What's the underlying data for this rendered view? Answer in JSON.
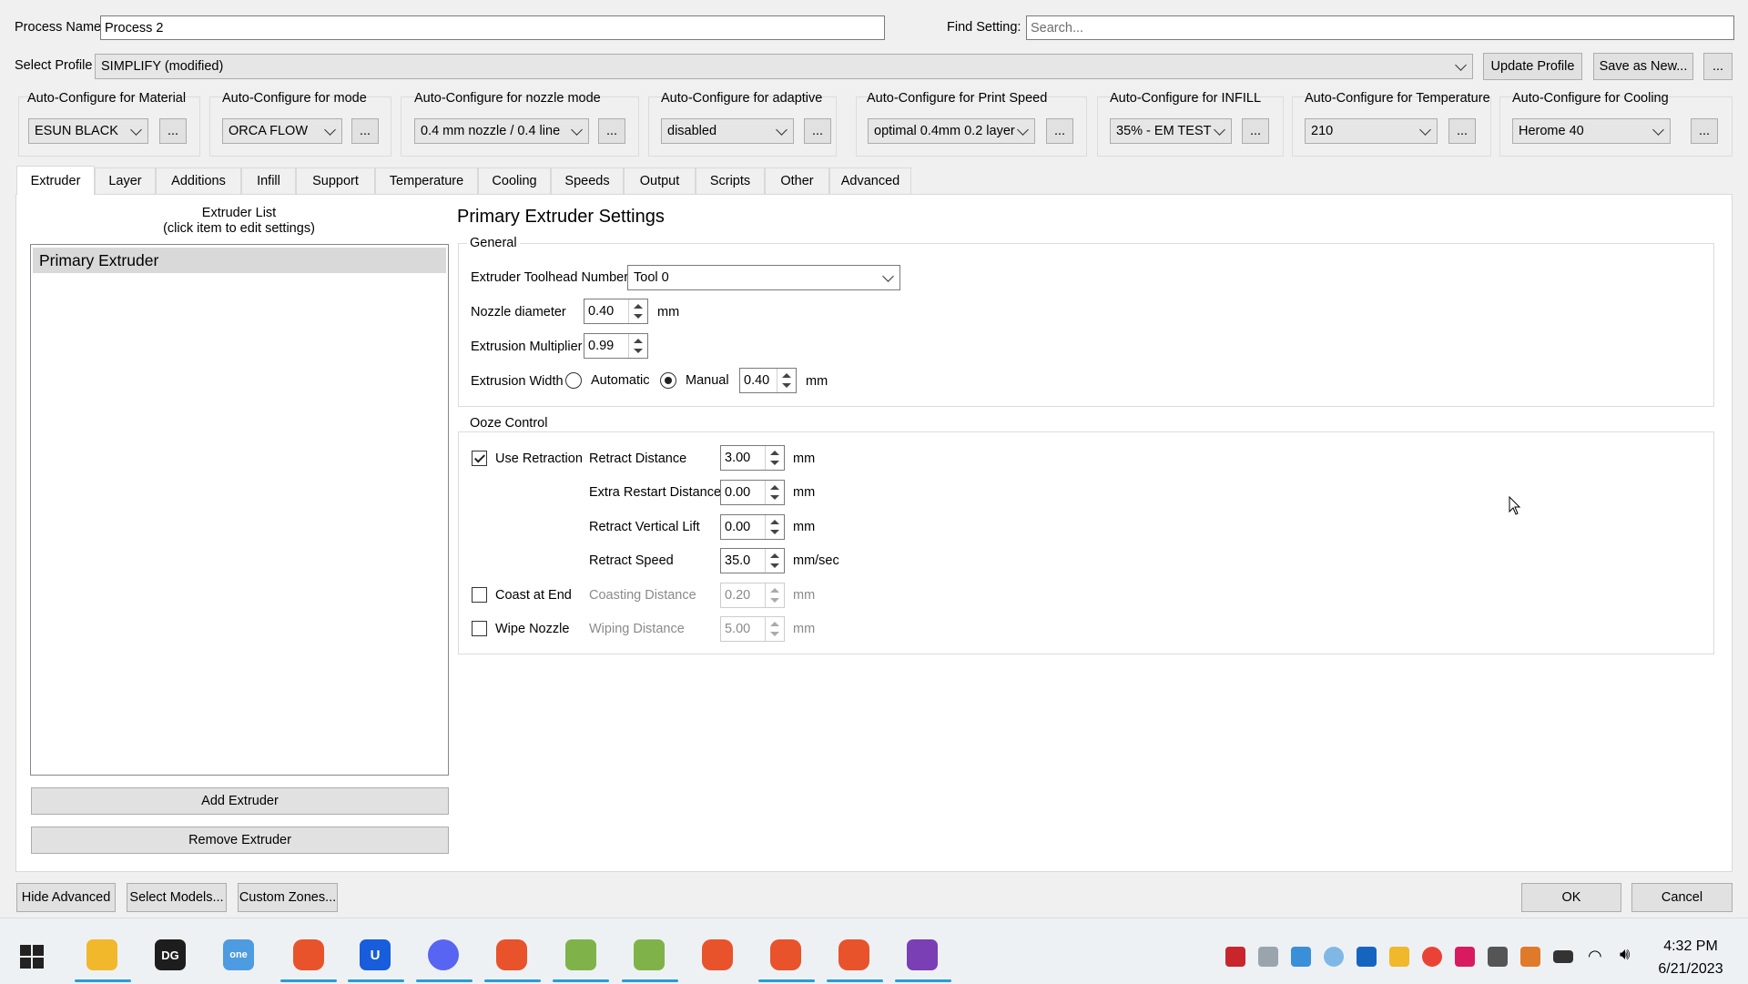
{
  "top": {
    "process_name_label": "Process Name",
    "process_name_value": "Process 2",
    "find_setting_label": "Find Setting:",
    "find_setting_placeholder": "Search...",
    "select_profile_label": "Select Profile",
    "select_profile_value": "SIMPLIFY (modified)",
    "update_profile": "Update Profile",
    "save_as_new": "Save as New...",
    "more": "..."
  },
  "autoconfig": [
    {
      "label": "Auto-Configure for Material",
      "value": "ESUN BLACK"
    },
    {
      "label": "Auto-Configure for mode",
      "value": "ORCA FLOW"
    },
    {
      "label": "Auto-Configure for nozzle mode",
      "value": "0.4 mm nozzle / 0.4 line"
    },
    {
      "label": "Auto-Configure for adaptive",
      "value": "disabled"
    },
    {
      "label": "Auto-Configure for Print Speed",
      "value": "optimal 0.4mm 0.2 layer"
    },
    {
      "label": "Auto-Configure for INFILL",
      "value": "35% - EM TEST"
    },
    {
      "label": "Auto-Configure for Temperature",
      "value": "210"
    },
    {
      "label": "Auto-Configure for Cooling",
      "value": "Herome 40"
    }
  ],
  "tabs": [
    "Extruder",
    "Layer",
    "Additions",
    "Infill",
    "Support",
    "Temperature",
    "Cooling",
    "Speeds",
    "Output",
    "Scripts",
    "Other",
    "Advanced"
  ],
  "extruder_list": {
    "title_line1": "Extruder List",
    "title_line2": "(click item to edit settings)",
    "items": [
      "Primary Extruder"
    ],
    "add_button": "Add Extruder",
    "remove_button": "Remove Extruder"
  },
  "settings": {
    "heading": "Primary Extruder Settings",
    "general_title": "General",
    "toolhead_label": "Extruder Toolhead Number",
    "toolhead_value": "Tool 0",
    "nozzle_label": "Nozzle diameter",
    "nozzle_value": "0.40",
    "nozzle_unit": "mm",
    "multiplier_label": "Extrusion Multiplier",
    "multiplier_value": "0.99",
    "width_label": "Extrusion Width",
    "width_auto": "Automatic",
    "width_manual": "Manual",
    "width_value": "0.40",
    "width_unit": "mm",
    "ooze_title": "Ooze Control",
    "use_retraction": "Use Retraction",
    "retract_distance_label": "Retract Distance",
    "retract_distance_value": "3.00",
    "extra_restart_label": "Extra Restart Distance",
    "extra_restart_value": "0.00",
    "vertical_lift_label": "Retract Vertical Lift",
    "vertical_lift_value": "0.00",
    "retract_speed_label": "Retract Speed",
    "retract_speed_value": "35.0",
    "coast_label": "Coast at End",
    "coasting_distance_label": "Coasting Distance",
    "coasting_distance_value": "0.20",
    "wipe_label": "Wipe Nozzle",
    "wiping_distance_label": "Wiping Distance",
    "wiping_distance_value": "5.00",
    "unit_mm": "mm",
    "unit_mmsec": "mm/sec"
  },
  "bottom": {
    "hide_advanced": "Hide Advanced",
    "select_models": "Select Models...",
    "custom_zones": "Custom Zones...",
    "ok": "OK",
    "cancel": "Cancel"
  },
  "taskbar": {
    "time": "4:32 PM",
    "date": "6/21/2023",
    "icons": [
      "windows-start-icon",
      "file-explorer-icon",
      "datagrip-icon",
      "onenote-icon",
      "brave-icon",
      "bitwarden-icon",
      "discord-icon",
      "brave-icon",
      "simplify3d-icon",
      "simplify3d-icon",
      "brave-icon",
      "brave-icon",
      "brave-icon",
      "app-icon"
    ]
  }
}
